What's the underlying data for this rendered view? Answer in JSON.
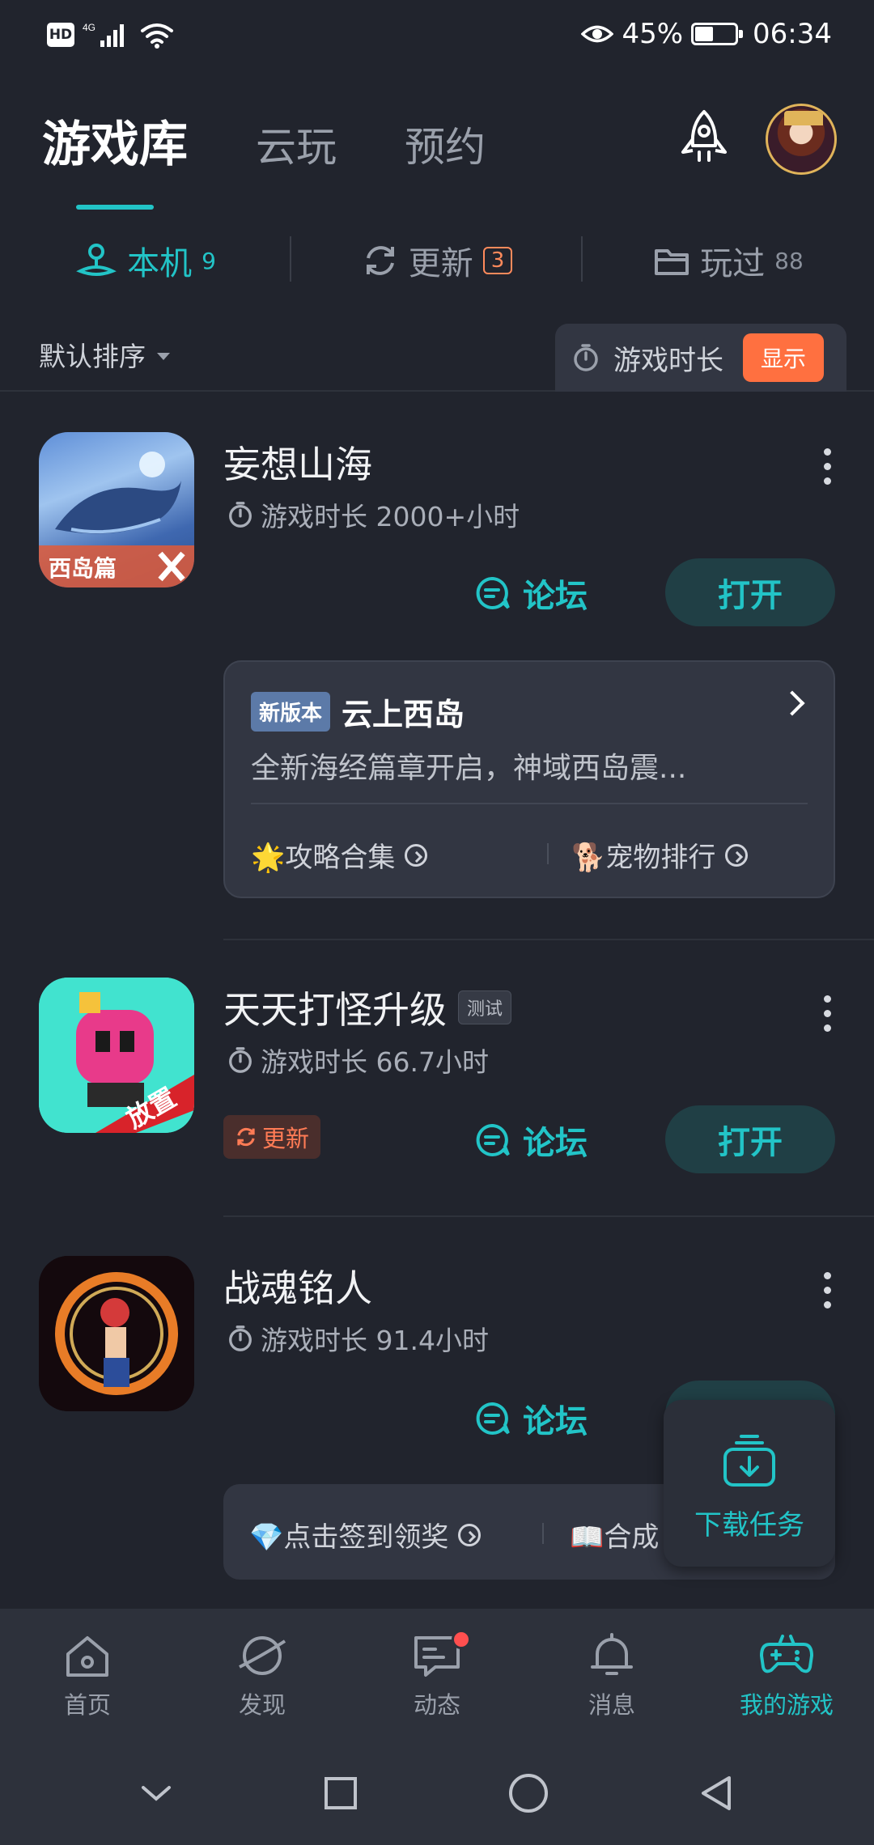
{
  "status_bar": {
    "hd": "HD",
    "network": "4G",
    "battery": "45%",
    "battery_level": 0.45,
    "time": "06:34"
  },
  "header": {
    "tabs": [
      {
        "label": "游戏库",
        "active": true
      },
      {
        "label": "云玩",
        "active": false
      },
      {
        "label": "预约",
        "active": false
      }
    ]
  },
  "filters": [
    {
      "label": "本机",
      "count": "9",
      "icon": "local-device-icon"
    },
    {
      "label": "更新",
      "count": "3",
      "icon": "refresh-icon"
    },
    {
      "label": "玩过",
      "count": "88",
      "icon": "folder-icon"
    }
  ],
  "sort": {
    "label": "默认排序",
    "playtime_label": "游戏时长",
    "show_label": "显示"
  },
  "games": [
    {
      "title": "妄想山海",
      "playtime": "游戏时长 2000+小时",
      "forum": "论坛",
      "open": "打开",
      "icon_text": "西岛篇",
      "news": {
        "tag": "新版本",
        "title": "云上西岛",
        "desc": "全新海经篇章开启，神域西岛震...",
        "links": [
          "🌟攻略合集",
          "🐕宠物排行"
        ]
      }
    },
    {
      "title": "天天打怪升级",
      "tag": "测试",
      "playtime": "游戏时长 66.7小时",
      "update": "更新",
      "forum": "论坛",
      "open": "打开",
      "icon_text": "放置"
    },
    {
      "title": "战魂铭人",
      "playtime": "游戏时长 91.4小时",
      "forum": "论坛",
      "links": [
        "💎点击签到领奖",
        "📖合成"
      ]
    }
  ],
  "download": {
    "label": "下载任务"
  },
  "bottom_nav": [
    {
      "label": "首页",
      "icon": "home-icon"
    },
    {
      "label": "发现",
      "icon": "planet-icon"
    },
    {
      "label": "动态",
      "icon": "chat-icon"
    },
    {
      "label": "消息",
      "icon": "bell-icon"
    },
    {
      "label": "我的游戏",
      "icon": "gamepad-icon",
      "active": true
    }
  ],
  "colors": {
    "background": "#21242d",
    "accent": "#22c4c7",
    "orange": "#ff7040"
  }
}
